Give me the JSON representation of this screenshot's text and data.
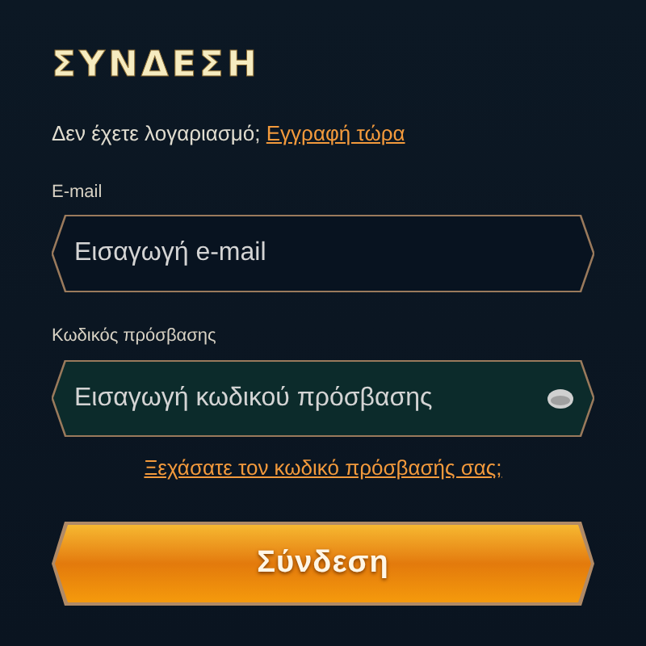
{
  "title": "ΣΥΝΔΕΣΗ",
  "signup_prompt": {
    "text": "Δεν έχετε λογαριασμό;",
    "link": "Εγγραφή τώρα"
  },
  "fields": [
    {
      "label": "E-mail",
      "placeholder": "Εισαγωγή e-mail",
      "focused": false,
      "kind": "text"
    },
    {
      "label": "Κωδικός πρόσβασης",
      "placeholder": "Εισαγωγή κωδικού πρόσβασης",
      "focused": true,
      "kind": "password"
    }
  ],
  "forgot_link": "Ξεχάσατε τον κωδικό πρόσβασής σας;",
  "submit_button": "Σύνδεση"
}
